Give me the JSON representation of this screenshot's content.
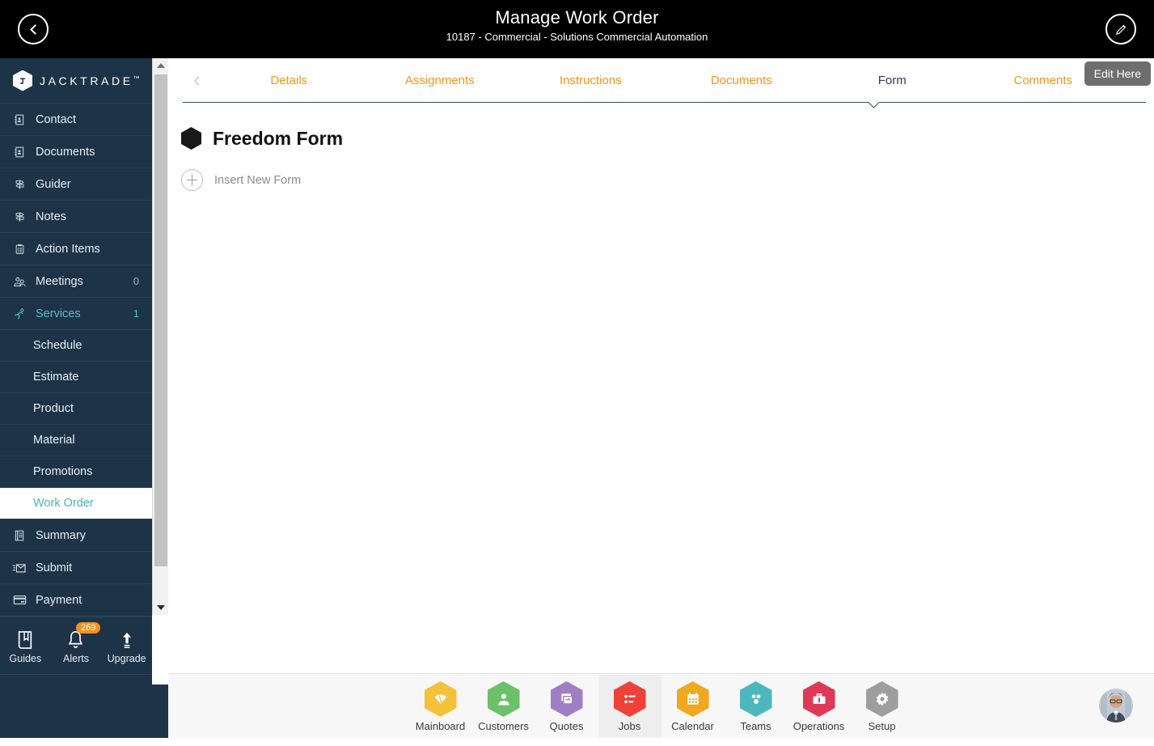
{
  "header": {
    "title": "Manage Work Order",
    "subtitle": "10187 - Commercial - Solutions Commercial Automation",
    "back_icon": "chevron-left-icon",
    "edit_icon": "pencil-icon",
    "bg_color": "#000000"
  },
  "sidebar": {
    "logo_text": "JACKTRADE",
    "logo_tm": "™",
    "bg_color": "#1d3348",
    "accent_color": "#4fc3c3",
    "items": [
      {
        "label": "Contact",
        "icon": "contact-book-icon",
        "count": ""
      },
      {
        "label": "Documents",
        "icon": "documents-icon",
        "count": ""
      },
      {
        "label": "Guider",
        "icon": "signpost-icon",
        "count": ""
      },
      {
        "label": "Notes",
        "icon": "signpost-icon",
        "count": ""
      },
      {
        "label": "Action Items",
        "icon": "clipboard-icon",
        "count": ""
      },
      {
        "label": "Meetings",
        "icon": "meetings-icon",
        "count": "0"
      },
      {
        "label": "Services",
        "icon": "services-icon",
        "count": "1",
        "active": true
      }
    ],
    "sub_items": [
      {
        "label": "Schedule"
      },
      {
        "label": "Estimate"
      },
      {
        "label": "Product"
      },
      {
        "label": "Material"
      },
      {
        "label": "Promotions"
      },
      {
        "label": "Work Order",
        "selected": true
      }
    ],
    "items_after": [
      {
        "label": "Summary",
        "icon": "summary-icon",
        "count": ""
      },
      {
        "label": "Submit",
        "icon": "submit-icon",
        "count": ""
      },
      {
        "label": "Payment",
        "icon": "payment-icon",
        "count": ""
      }
    ],
    "quick_actions": [
      {
        "label": "Guides",
        "icon": "book-icon",
        "badge": ""
      },
      {
        "label": "Alerts",
        "icon": "bell-icon",
        "badge": "269"
      },
      {
        "label": "Upgrade",
        "icon": "upload-arrow-icon",
        "badge": ""
      }
    ],
    "hex_shortcuts": [
      {
        "icon": "person-icon"
      },
      {
        "icon": "dollar-icon"
      },
      {
        "icon": "transfer-icon"
      },
      {
        "icon": "workflow-icon"
      }
    ],
    "badge_color": "#f4921e",
    "hex_color": "#4fb5b0"
  },
  "tabs": {
    "prev_icon": "chevron-left-icon",
    "next_icon": "chevron-right-icon",
    "items": [
      {
        "label": "Details",
        "active": false
      },
      {
        "label": "Assignments",
        "active": false
      },
      {
        "label": "Instructions",
        "active": false
      },
      {
        "label": "Documents",
        "active": false
      },
      {
        "label": "Form",
        "active": true
      },
      {
        "label": "Comments",
        "active": false
      }
    ],
    "inactive_color": "#f5941d",
    "active_color": "#2f3e4e"
  },
  "tooltip": {
    "label": "Edit Here",
    "bg_color": "#6e6e6e"
  },
  "content": {
    "form_title": "Freedom Form",
    "form_icon": "hexagon-icon",
    "insert_label": "Insert New Form",
    "insert_icon": "plus-circle-icon"
  },
  "bottom_nav": {
    "items": [
      {
        "label": "Mainboard",
        "icon": "mainboard-icon",
        "color": "#f5c13b",
        "active": false
      },
      {
        "label": "Customers",
        "icon": "customers-icon",
        "color": "#6cc06a",
        "active": false
      },
      {
        "label": "Quotes",
        "icon": "quotes-icon",
        "color": "#a07ec4",
        "active": false
      },
      {
        "label": "Jobs",
        "icon": "jobs-icon",
        "color": "#ef4136",
        "active": true
      },
      {
        "label": "Calendar",
        "icon": "calendar-icon",
        "color": "#f0a81e",
        "active": false
      },
      {
        "label": "Teams",
        "icon": "teams-icon",
        "color": "#4cb8bd",
        "active": false
      },
      {
        "label": "Operations",
        "icon": "operations-icon",
        "color": "#e03857",
        "active": false
      },
      {
        "label": "Setup",
        "icon": "setup-icon",
        "color": "#9e9e9e",
        "active": false
      }
    ],
    "avatar": "user-avatar"
  }
}
